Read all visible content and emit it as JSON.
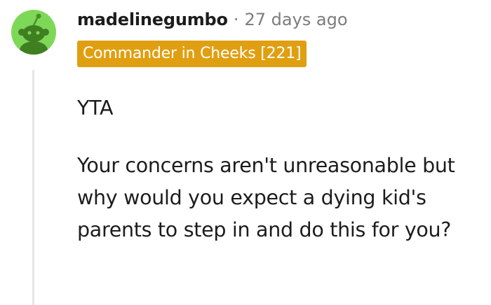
{
  "comment": {
    "author": "madelinegumbo",
    "separator": "·",
    "timestamp": "27 days ago",
    "flair": "Commander in Cheeks [221]",
    "body": [
      "YTA",
      "Your concerns aren't unreasonable but why would you expect a dying kid's parents to step in and do this for you?"
    ]
  },
  "avatar": {
    "icon": "reddit-snoo-icon",
    "color": "#7ed858"
  },
  "colors": {
    "flair_bg": "#e09f10",
    "meta_text": "#7c7c7c",
    "thread_line": "#e5e5e5"
  }
}
